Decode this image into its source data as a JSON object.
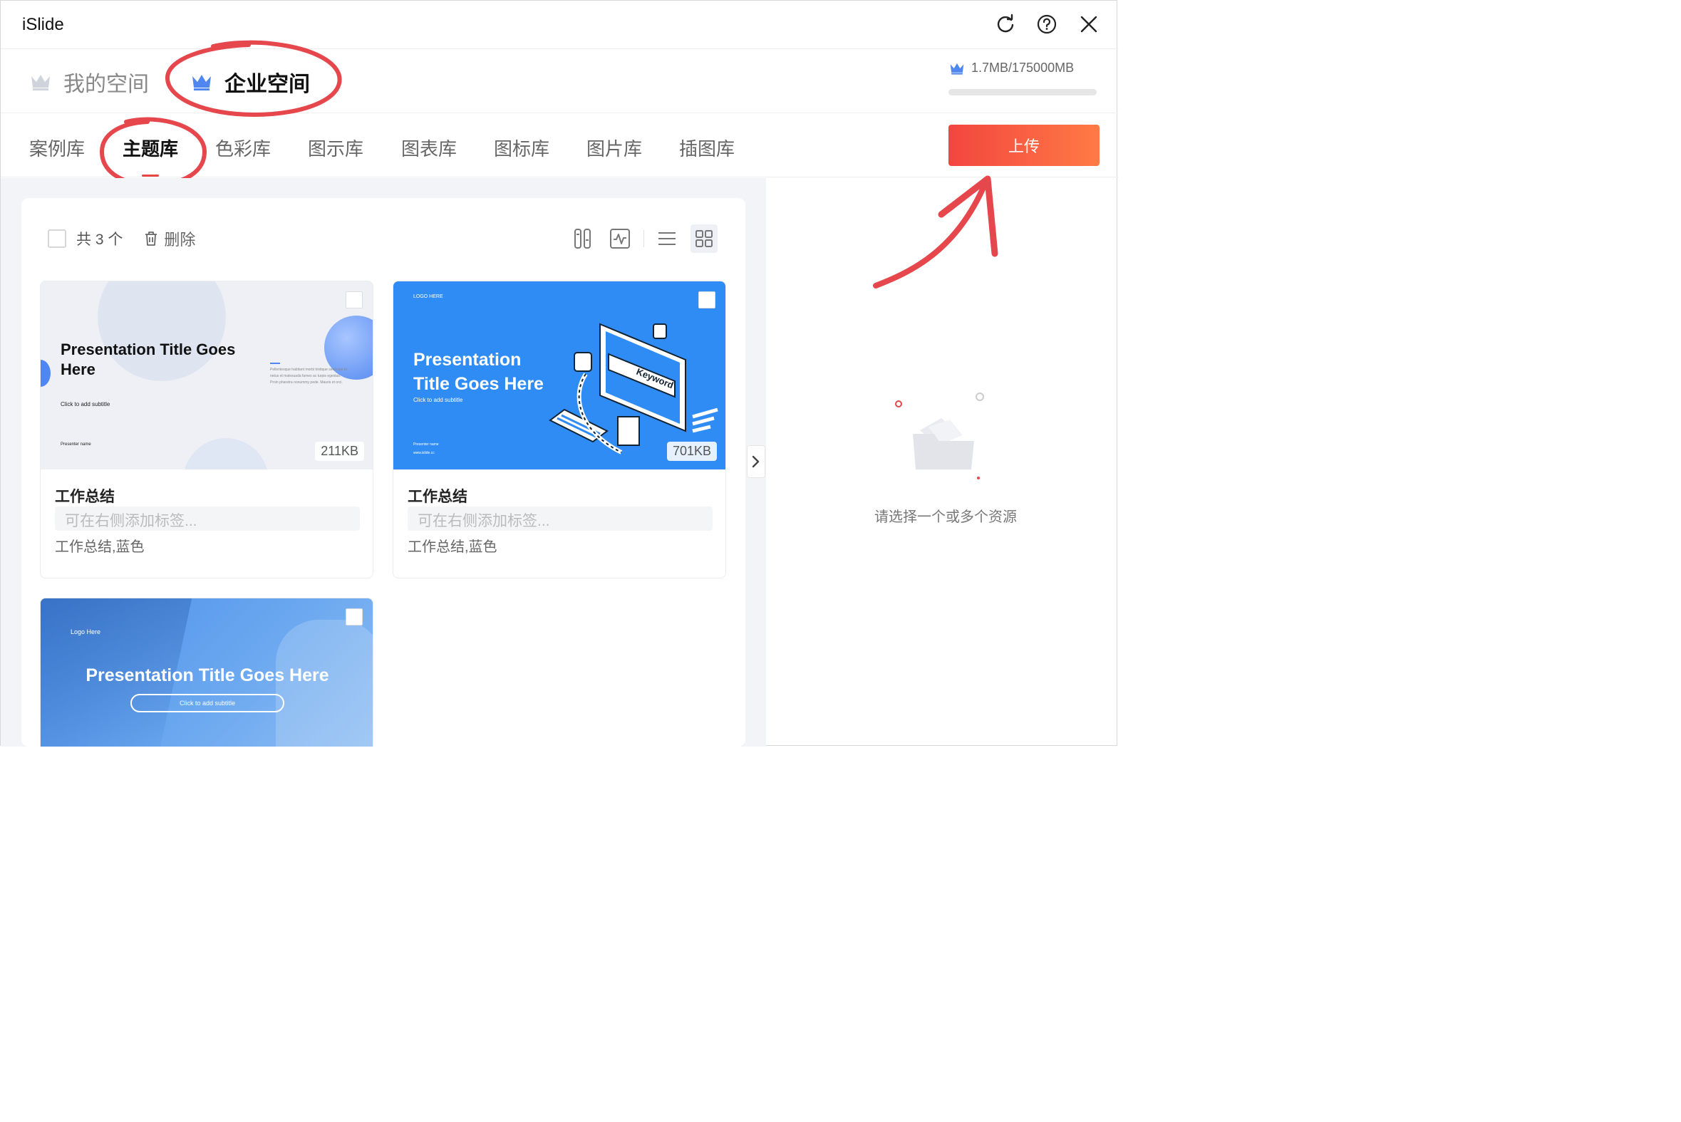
{
  "app_title": "iSlide",
  "window_controls": {
    "refresh": "refresh-icon",
    "help": "help-icon",
    "close": "close-icon"
  },
  "spaces": {
    "my_space": "我的空间",
    "enterprise_space": "企业空间"
  },
  "quota": {
    "text": "1.7MB/175000MB",
    "fraction_used": 1e-05
  },
  "library_tabs": [
    "案例库",
    "主题库",
    "色彩库",
    "图示库",
    "图表库",
    "图标库",
    "图片库",
    "插图库"
  ],
  "active_tab": "主题库",
  "upload_label": "上传",
  "toolbar": {
    "count_label": "共 3 个",
    "delete_label": "删除"
  },
  "cards": [
    {
      "size": "211KB",
      "title": "工作总结",
      "tag_placeholder": "可在右侧添加标签...",
      "keywords": "工作总结,蓝色",
      "thumb": {
        "heading": "Presentation Title Goes Here",
        "subtitle": "Click to add subtitle",
        "presenter": "Presenter name",
        "body": "Pellentesque habitant morbi tristique senectus et netus et malesuada fames ac turpis egestas. Proin pharetra nonummy pede. Mauris et orci."
      }
    },
    {
      "size": "701KB",
      "title": "工作总结",
      "tag_placeholder": "可在右侧添加标签...",
      "keywords": "工作总结,蓝色",
      "thumb": {
        "logo": "LOGO HERE",
        "heading_line1": "Presentation",
        "heading_line2": "Title Goes Here",
        "subtitle": "Click to add subtitle",
        "presenter": "Presenter name",
        "url": "www.islide.cc",
        "keyword": "Keyword"
      }
    },
    {
      "thumb": {
        "logo": "Logo Here",
        "heading": "Presentation Title Goes Here",
        "subtitle": "Click to add subtitle"
      }
    }
  ],
  "empty_state": "请选择一个或多个资源",
  "colors": {
    "accent_red": "#f2463f",
    "accent_orange": "#ff7a45",
    "crown_blue": "#4f86ef",
    "thumb_blue": "#2f8cf5"
  }
}
